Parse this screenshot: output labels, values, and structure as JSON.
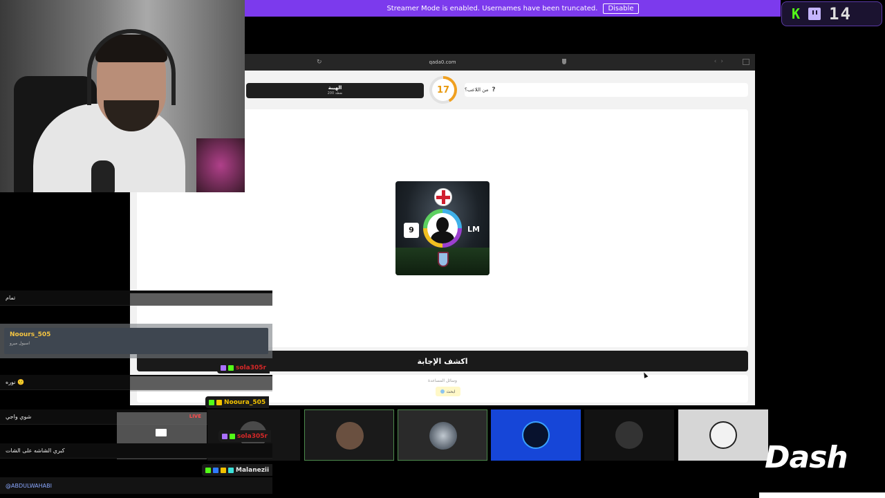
{
  "banner": {
    "text": "Streamer Mode is enabled. Usernames have been truncated.",
    "button": "Disable"
  },
  "viewers": {
    "kick_label": "K",
    "count": "14"
  },
  "browser": {
    "url": "qada0.com"
  },
  "game": {
    "team_name": "الهيبة",
    "team_points": "200 نقطة",
    "timer": "17",
    "timer_progress_percent": 42,
    "question": "من اللاعب؟",
    "question_mark": "?",
    "shirt_number": "9",
    "position": "LM",
    "reveal_button": "اكشف الإجابة",
    "aid_title": "وسائل المساعدة",
    "aid_button": "ابحث"
  },
  "chat": {
    "msg1": "تمام",
    "highlight_user": "Noours_505",
    "highlight_msg": "اسيول ميرو",
    "user1": "sola305r",
    "msg2": "نوره 🙂",
    "user2": "Nooura_505",
    "msg3": "شوي واجي",
    "user3": "sola305r",
    "msg4": "كبري الشاشه على الشات",
    "user4": "Malanezii",
    "mention": "@ABDULWAHABI"
  },
  "live_tile": {
    "tag": "LIVE"
  },
  "logo": {
    "text": "Dash"
  }
}
